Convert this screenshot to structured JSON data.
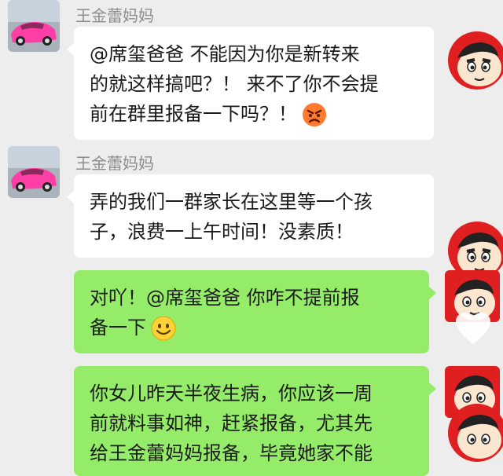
{
  "messages": [
    {
      "sender": "王金蕾妈妈",
      "lines": [
        "@席玺爸爸 不能因为你是新转来",
        "的就这样搞吧？！ 来不了你不会提",
        "前在群里报备一下吗？！"
      ],
      "emoji": "angry-face-icon"
    },
    {
      "sender": "王金蕾妈妈",
      "lines": [
        "弄的我们一群家长在这里等一个孩",
        "子，浪费一上午时间！没素质！"
      ]
    },
    {
      "lines": [
        "对吖！@席玺爸爸 你咋不提前报",
        "备一下"
      ],
      "emoji": "smiling-face-icon"
    },
    {
      "lines": [
        "你女儿昨天半夜生病，你应该一周",
        "前就料事如神，赶紧报备，尤其先",
        "给王金蕾妈妈报备，毕竟她家不能"
      ]
    }
  ],
  "colors": {
    "background": "#ededed",
    "incoming_bubble": "#ffffff",
    "outgoing_bubble": "#95ec69",
    "avatar_red": "#e02020"
  }
}
